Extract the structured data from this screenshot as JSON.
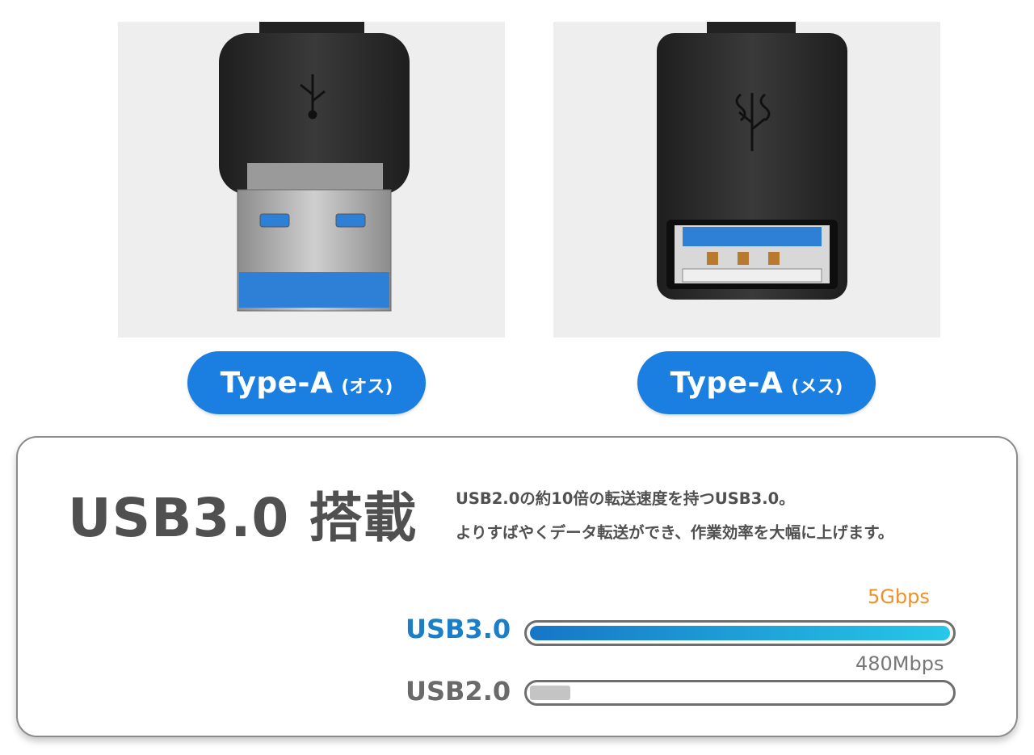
{
  "photos": {
    "male": {
      "label": "Type-A",
      "sub": "(オス)"
    },
    "female": {
      "label": "Type-A",
      "sub": "(メス)"
    }
  },
  "feature": {
    "title": "USB3.0 搭載",
    "desc_line1": "USB2.0の約10倍の転送速度を持つUSB3.0。",
    "desc_line2": "よりすばやくデータ転送ができ、作業効率を大幅に上げます。"
  },
  "speeds": [
    {
      "label": "USB3.0",
      "value": "5Gbps",
      "level": 1.0,
      "color": "#1a7fc8"
    },
    {
      "label": "USB2.0",
      "value": "480Mbps",
      "level": 0.096,
      "color": "#6a6a6a"
    }
  ],
  "colors": {
    "accent": "#1a7fe0",
    "usb3": "#1a7fc8",
    "usb3_value": "#f09025",
    "usb_blue": "#2e7fd6"
  }
}
